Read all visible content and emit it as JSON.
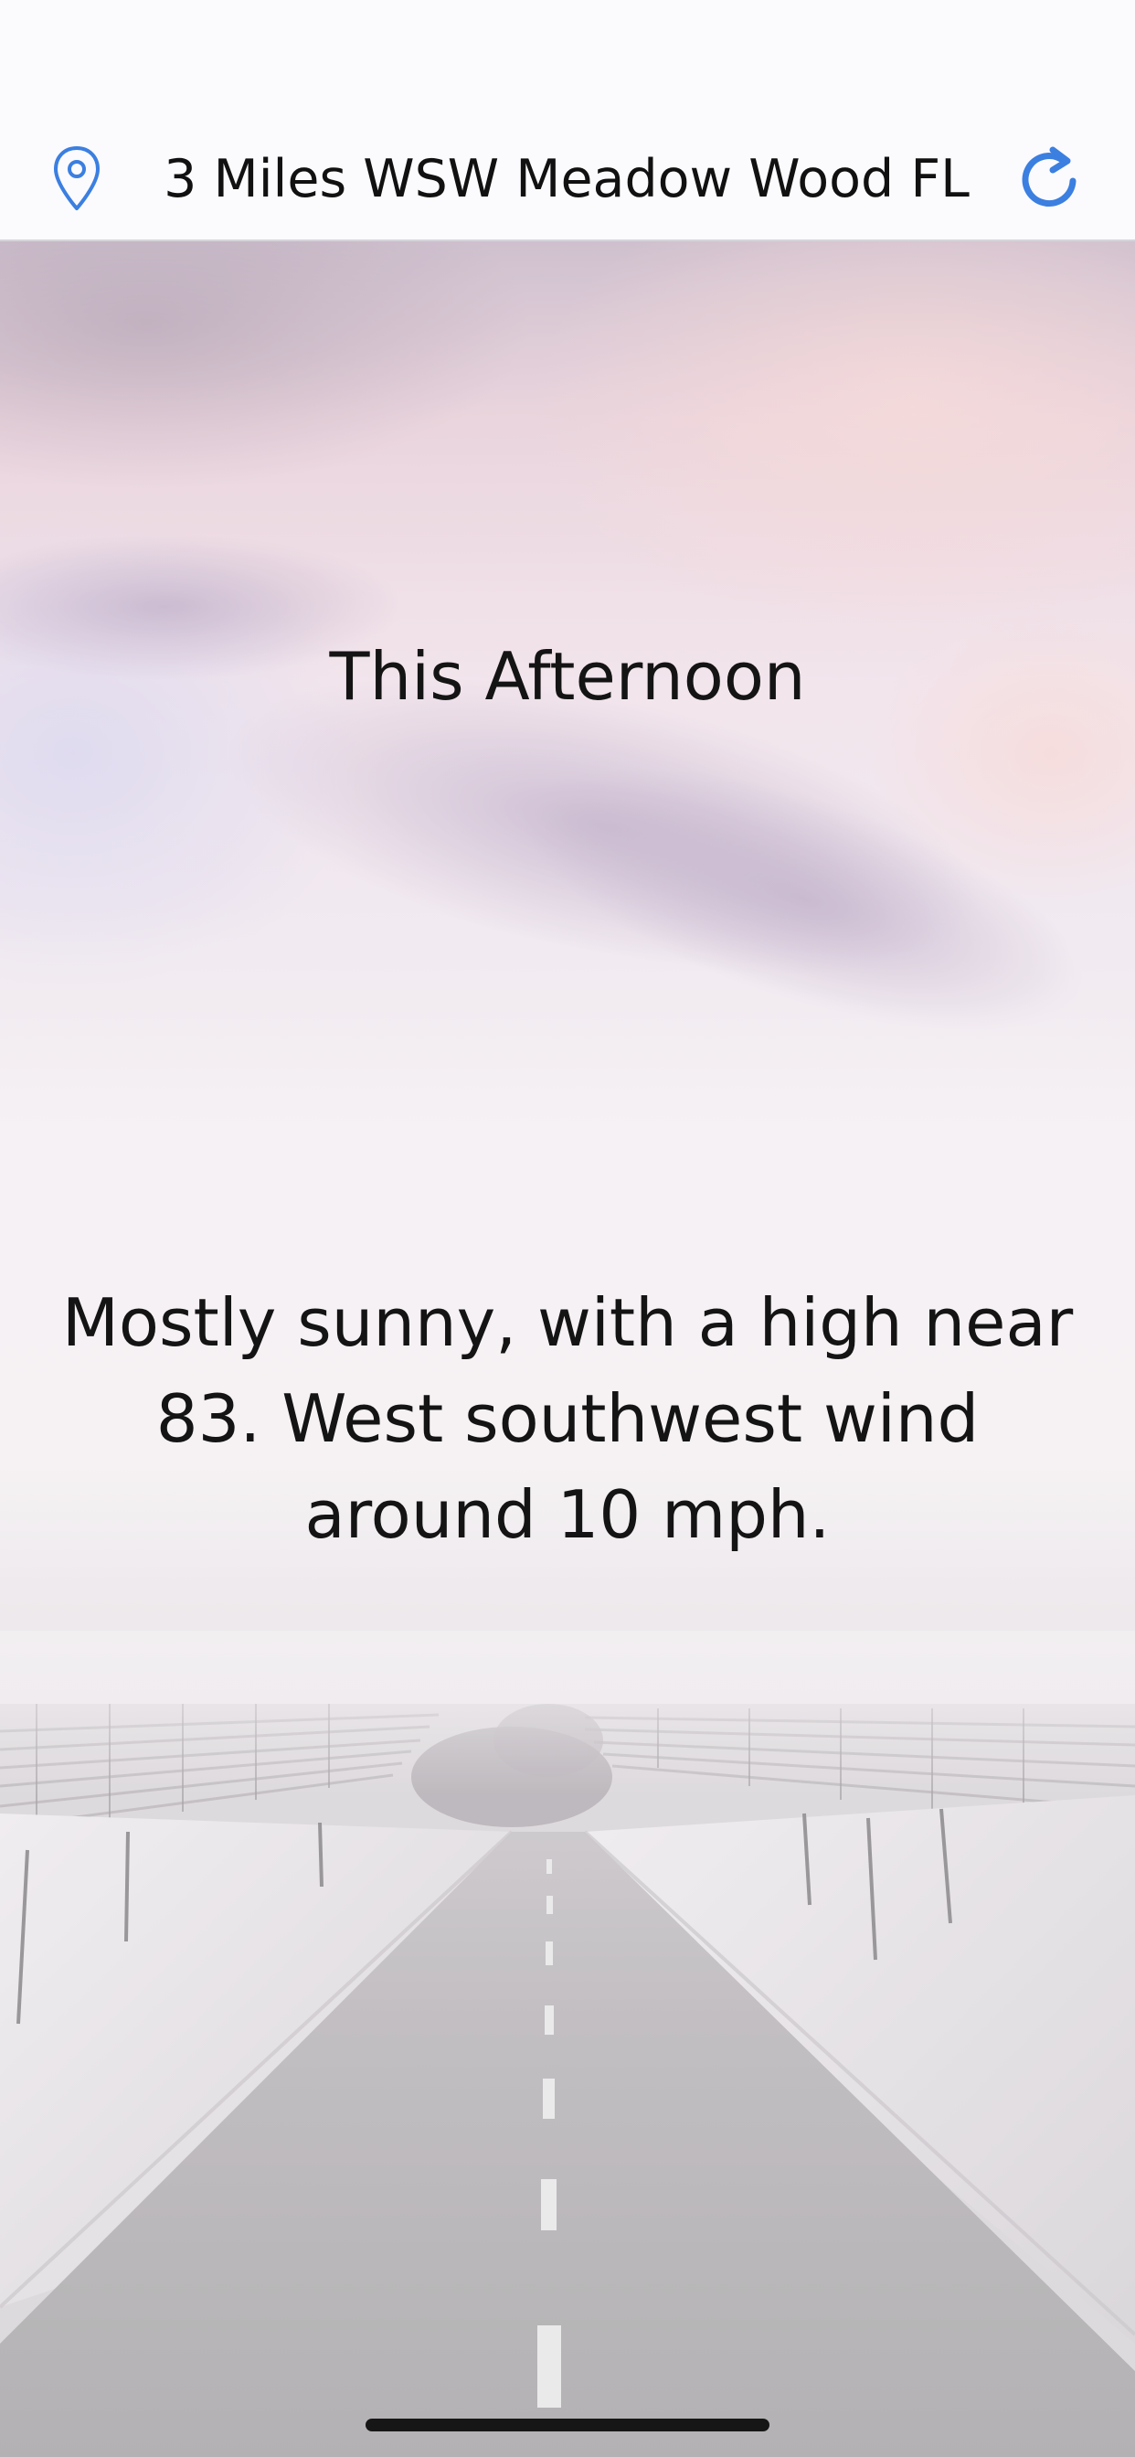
{
  "header": {
    "location_title": "3 Miles WSW Meadow Wood FL",
    "location_icon": "map-pin-icon",
    "refresh_icon": "refresh-icon",
    "accent_color": "#3b7fe0"
  },
  "forecast": {
    "period_name": "This Afternoon",
    "detailed_text": "Mostly sunny, with a high near 83. West southwest wind around 10 mph."
  },
  "background": {
    "scene": "snowy road under pastel sky"
  }
}
